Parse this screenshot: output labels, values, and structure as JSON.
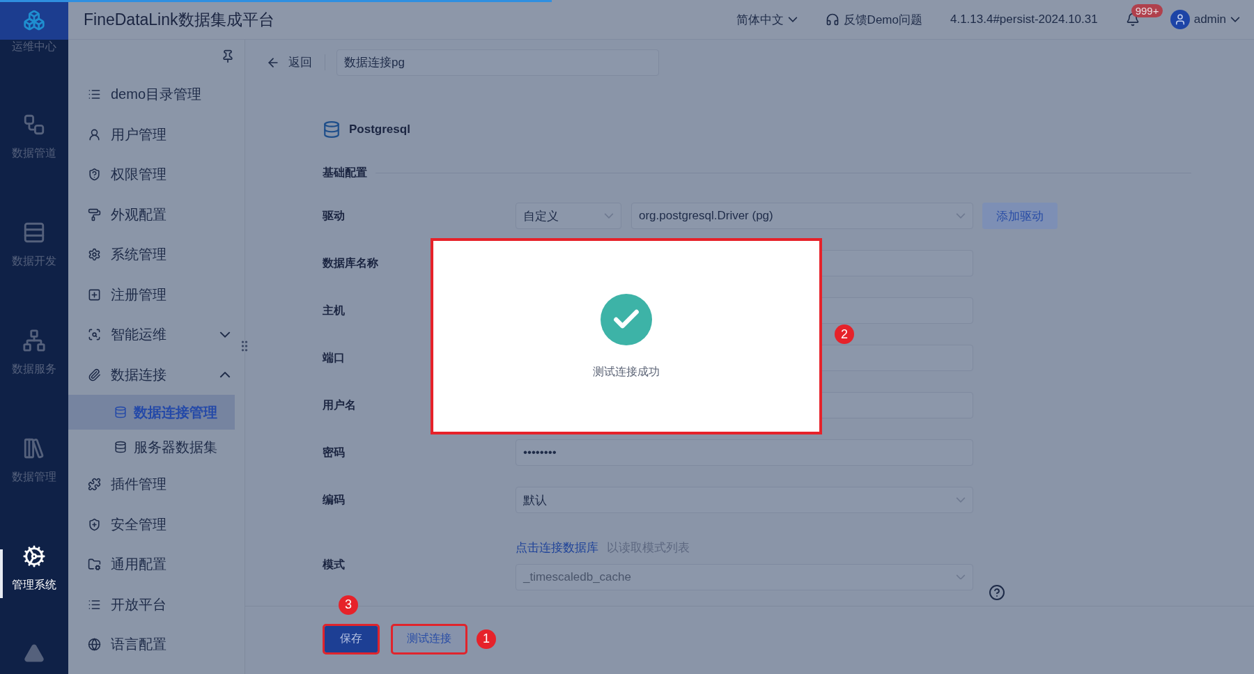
{
  "loading_bar": {
    "level": 0.44
  },
  "header": {
    "app_title": "FineDataLink数据集成平台",
    "language": "简体中文",
    "feedback": "反馈Demo问题",
    "version": "4.1.13.4#persist-2024.10.31",
    "notification_badge": "999+",
    "user": "admin"
  },
  "rail": [
    {
      "label": "运维中心",
      "selected": false
    },
    {
      "label": "数据管道",
      "selected": false
    },
    {
      "label": "数据开发",
      "selected": false
    },
    {
      "label": "数据服务",
      "selected": false
    },
    {
      "label": "数据管理",
      "selected": false
    },
    {
      "label": "管理系统",
      "selected": true
    }
  ],
  "sidebar": {
    "items": [
      {
        "label": "demo目录管理",
        "selected": false
      },
      {
        "label": "用户管理",
        "selected": false
      },
      {
        "label": "权限管理",
        "selected": false
      },
      {
        "label": "外观配置",
        "selected": false
      },
      {
        "label": "系统管理",
        "selected": false
      },
      {
        "label": "注册管理",
        "selected": false
      },
      {
        "label": "智能运维",
        "selected": false,
        "expanded": false
      },
      {
        "label": "数据连接",
        "selected": false,
        "expanded": true,
        "children": [
          {
            "label": "数据连接管理",
            "selected": true
          },
          {
            "label": "服务器数据集",
            "selected": false
          }
        ]
      },
      {
        "label": "插件管理",
        "selected": false
      },
      {
        "label": "安全管理",
        "selected": false
      },
      {
        "label": "通用配置",
        "selected": false
      },
      {
        "label": "开放平台",
        "selected": false
      },
      {
        "label": "语言配置",
        "selected": false
      }
    ]
  },
  "toolbar": {
    "back": "返回",
    "name_field": "数据连接pg"
  },
  "form": {
    "connector": "Postgresql",
    "section": "基础配置",
    "fields": [
      {
        "kind": "driver",
        "label": "驱动",
        "values": [
          "自定义",
          "org.postgresql.Driver (pg)"
        ],
        "button": "添加驱动"
      },
      {
        "kind": "text",
        "label": "数据库名称"
      },
      {
        "kind": "text",
        "label": "主机"
      },
      {
        "kind": "text",
        "label": "端口"
      },
      {
        "kind": "text",
        "label": "用户名"
      },
      {
        "kind": "password",
        "label": "密码",
        "value": "••••••••"
      },
      {
        "kind": "select",
        "label": "编码",
        "value": "默认"
      },
      {
        "kind": "schema",
        "label": "模式",
        "link": "点击连接数据库",
        "hint": "以读取模式列表",
        "value": "_timescaledb_cache",
        "disabled": true
      }
    ]
  },
  "footer": {
    "buttons": [
      {
        "label": "保存",
        "kind": "primary",
        "highlighted": true,
        "marker": "3"
      },
      {
        "label": "测试连接",
        "kind": "secondary",
        "highlighted": true,
        "marker": "1"
      }
    ]
  },
  "modal": {
    "message": "测试连接成功",
    "highlighted": true,
    "marker": "2"
  }
}
